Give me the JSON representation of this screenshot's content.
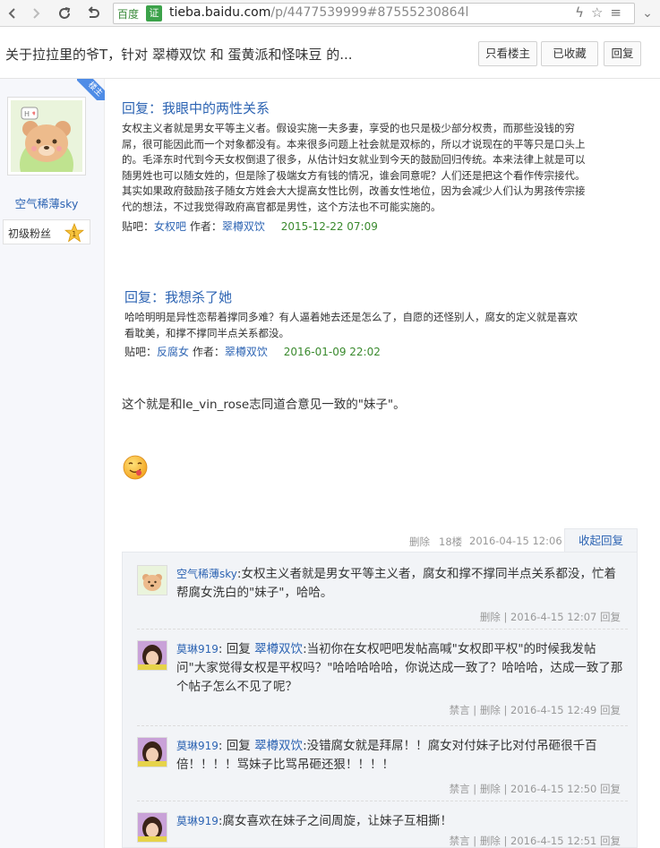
{
  "browser": {
    "url_site": "百度",
    "url_badge": "证",
    "url_host": "tieba.baidu.com",
    "url_path": "/p/4477539999#87555230864l",
    "back_icon": "chevron-left-icon",
    "forward_icon": "chevron-right-icon",
    "reload_icon": "reload-icon",
    "undo_icon": "undo-icon"
  },
  "thread": {
    "title": "关于拉拉里的爷T，针对 翠樽双饮 和 蛋黄派和怪味豆 的...",
    "btn_only_op": "只看楼主",
    "btn_collected": "已收藏",
    "btn_reply": "回复"
  },
  "author": {
    "badge": "楼主",
    "name": "空气稀薄sky",
    "level_label": "初级粉丝",
    "level_num": "1"
  },
  "quotes": [
    {
      "title": "回复：我眼中的两性关系",
      "body": "女权主义者就是男女平等主义者。假设实施一夫多妻，享受的也只是极少部分权贵，而那些没钱的穷屌，很可能因此而一个对象都没有。本来很多问题上社会就是双标的，所以才说现在的平等只是口头上的。毛泽东时代到今天女权倒退了很多，从估计妇女就业到今天的鼓励回归传统。本来法律上就是可以随男姓也可以随女姓的，但是除了极端女方有钱的情况，谁会同意呢？人们还是把这个看作传宗接代。其实如果政府鼓励孩子随女方姓会大大提高女性比例，改善女性地位，因为会减少人们认为男孩传宗接代的想法，不过我觉得政府高官都是男性，这个方法也不可能实施的。",
      "bar_label": "贴吧：",
      "bar_name": "女权吧",
      "author_label": "作者：",
      "author_name": "翠樽双饮",
      "time": "2015-12-22 07:09"
    },
    {
      "title": "回复：我想杀了她",
      "body": "哈哈明明是异性恋帮着撑同多难？有人逼着她去还是怎么了，自愿的还怪别人，腐女的定义就是喜欢看耽美，和撑不撑同半点关系都没。",
      "bar_label": "贴吧：",
      "bar_name": "反腐女",
      "author_label": "作者：",
      "author_name": "翠樽双饮",
      "time": "2016-01-09 22:02"
    }
  ],
  "post": {
    "text": "这个就是和le_vin_rose志同道合意见一致的\"妹子\"。",
    "footer_delete": "删除",
    "footer_floor": "18楼",
    "footer_time": "2016-04-15 12:06",
    "footer_collapse": "收起回复"
  },
  "comments": [
    {
      "user": "空气稀薄sky",
      "sep": ":",
      "text": "女权主义者就是男女平等主义者，腐女和撑不撑同半点关系都没，忙着帮腐女洗白的\"妹子\"，哈哈。",
      "actions": "删除 | 2016-4-15 12:07  回复"
    },
    {
      "user": "莫琳919",
      "sep": ":",
      "reply_word": "回复 ",
      "reply_to": "翠樽双饮",
      "text": ":当初你在女权吧吧发帖高喊\"女权即平权\"的时候我发帖问\"大家觉得女权是平权吗？\"哈哈哈哈哈，你说达成一致了？哈哈哈，达成一致了那个帖子怎么不见了呢？",
      "actions": "禁言 | 删除 | 2016-4-15 12:49  回复"
    },
    {
      "user": "莫琳919",
      "sep": ":",
      "reply_word": "回复 ",
      "reply_to": "翠樽双饮",
      "text": ":没错腐女就是拜屌！！腐女对付妹子比对付吊砸很千百倍！！！！骂妹子比骂吊砸还狠！！！！",
      "actions": "禁言 | 删除 | 2016-4-15 12:50  回复"
    },
    {
      "user": "莫琳919",
      "sep": ":",
      "text": "腐女喜欢在妹子之间周旋，让妹子互相撕！",
      "actions": "禁言 | 删除 | 2016-4-15 12:51  回复"
    }
  ],
  "colors": {
    "link_blue": "#2d64b3",
    "time_green": "#3a8a2e",
    "comment_bg": "#f2f4f7",
    "author_col_bg": "#f6f7fb"
  }
}
